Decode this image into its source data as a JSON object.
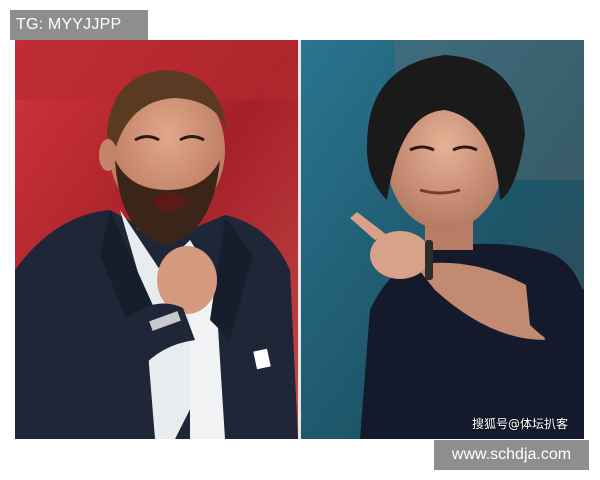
{
  "top_tag": "TG: MYYJJPP",
  "caption": "搜狐号@体坛扒客",
  "bottom_url": "www.schdja.com",
  "colors": {
    "label_bg": "#8e8e8e",
    "left_bg": "#c0282e",
    "right_bg": "#1f5f78"
  }
}
